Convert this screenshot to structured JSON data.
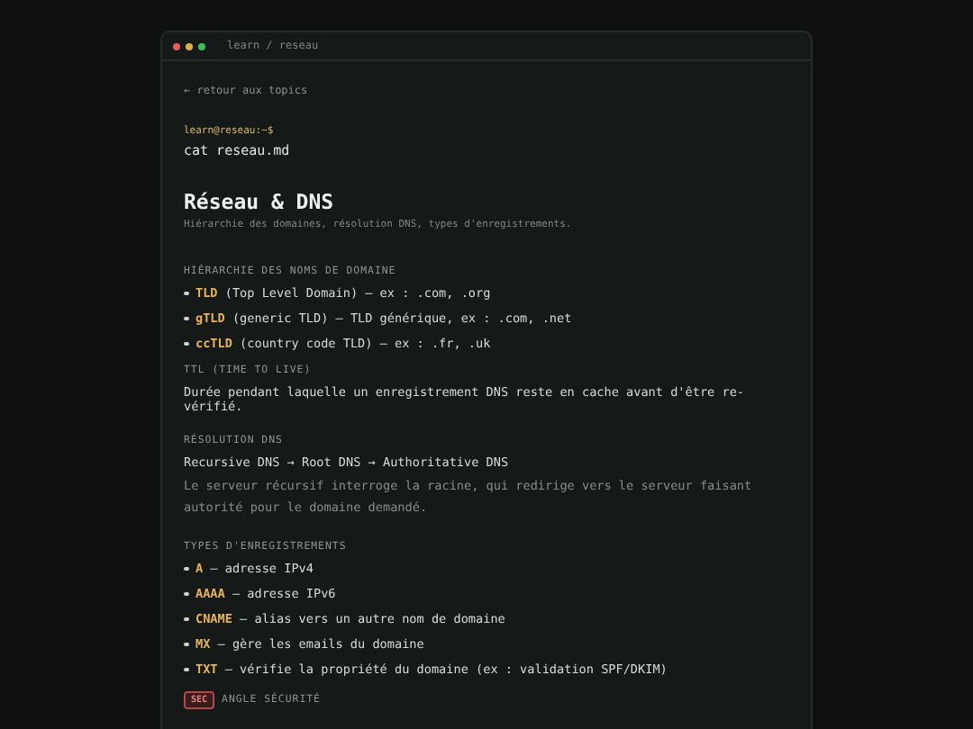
{
  "window": {
    "title": "learn / reseau"
  },
  "back_link": "← retour aux topics",
  "prompt": "learn@reseau:~$",
  "command": "cat reseau.md",
  "title": "Réseau & DNS",
  "subtitle": "Hiérarchie des domaines, résolution DNS, types d'enregistrements.",
  "sections": [
    {
      "kind": "list",
      "heading": "HIÉRARCHIE DES NOMS DE DOMAINE",
      "items": [
        {
          "term": "TLD",
          "text": "(Top Level Domain) — ex : .com, .org"
        },
        {
          "term": "gTLD",
          "text": "(generic TLD) — TLD générique, ex : .com, .net"
        },
        {
          "term": "ccTLD",
          "text": "(country code TLD) — ex : .fr, .uk"
        }
      ]
    },
    {
      "kind": "text",
      "heading": "TTL (TIME TO LIVE)",
      "text": "Durée pendant laquelle un enregistrement DNS reste en cache avant d'être re-vérifié."
    },
    {
      "kind": "flow",
      "heading": "RÉSOLUTION DNS",
      "text": "Recursive DNS → Root DNS → Authoritative DNS",
      "note": "Le serveur récursif interroge la racine, qui redirige vers le serveur faisant autorité pour le domaine demandé."
    },
    {
      "kind": "list",
      "heading": "TYPES D'ENREGISTREMENTS",
      "items": [
        {
          "term": "A",
          "text": "— adresse IPv4"
        },
        {
          "term": "AAAA",
          "text": "— adresse IPv6"
        },
        {
          "term": "CNAME",
          "text": "— alias vers un autre nom de domaine"
        },
        {
          "term": "MX",
          "text": "— gère les emails du domaine"
        },
        {
          "term": "TXT",
          "text": "— vérifie la propriété du domaine (ex : validation SPF/DKIM)"
        }
      ]
    },
    {
      "kind": "badge",
      "badge": "SEC",
      "heading": "ANGLE SÉCURITÉ"
    }
  ]
}
